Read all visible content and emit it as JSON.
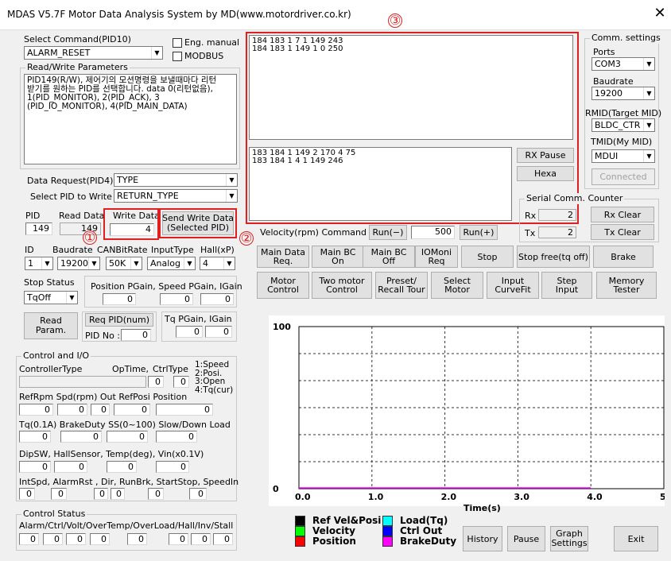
{
  "window": {
    "title": "MDAS V5.7F Motor Data Analysis System by MD(www.motordriver.co.kr)",
    "close": "✕"
  },
  "annotations": {
    "n1": "①",
    "n2": "②",
    "n3": "③"
  },
  "cmd": {
    "label": "Select Command(PID10)",
    "value": "ALARM_RESET",
    "eng_manual": "Eng. manual",
    "modbus": "MODBUS"
  },
  "rw": {
    "title": "Read/Write Parameters",
    "description": "PID149(R/W), 제어기의 모션명령을 보낼때마다 리턴\n받기를 원하는 PID를 선택합니다. data 0(리턴없음),\n1(PID_MONITOR), 2(PID_ACK), 3\n(PID_IO_MONITOR), 4(PID_MAIN_DATA)"
  },
  "data_request": {
    "label": "Data Request(PID4)",
    "value": "TYPE"
  },
  "select_pid": {
    "label": "Select PID to Write",
    "value": "RETURN_TYPE"
  },
  "pid": {
    "label": "PID",
    "value": "149",
    "read_label": "Read Data",
    "read_value": "149",
    "write_label": "Write Data",
    "write_value": "4",
    "send_button": "Send Write Data\n(Selected PID)"
  },
  "idrow": {
    "id_label": "ID",
    "id_value": "1",
    "baud_label": "Baudrate",
    "baud_value": "19200",
    "can_label": "CANBitRate",
    "can_value": "50K",
    "input_label": "InputType",
    "input_value": "Analog",
    "hall_label": "Hall(xP)",
    "hall_value": "4"
  },
  "stop": {
    "label": "Stop Status",
    "value": "TqOff"
  },
  "gains": {
    "label": "Position PGain, Speed PGain, IGain",
    "values": [
      "0",
      "0",
      "0"
    ]
  },
  "read_param": "Read\nParam.",
  "req_pid": {
    "button": "Req PID(num)",
    "pid_no_label": "PID No :",
    "pid_no": "0"
  },
  "tq_gain": {
    "label": "Tq PGain, IGain",
    "values": [
      "0",
      "0"
    ]
  },
  "control_io": {
    "title": "Control and I/O",
    "controller_type": "ControllerType",
    "optime": "OpTime,",
    "ctrltype": "CtrlType",
    "optime_value": "0",
    "ctrltype_value": "0",
    "legend": "1:Speed\n2:Posi.\n3:Open\n4:Tq(cur)",
    "row2_label": "RefRpm  Spd(rpm)  Out  RefPosi   Position",
    "row2_values": [
      "0",
      "0",
      "0",
      "0",
      "0"
    ],
    "row3_label": "Tq(0.1A)  BrakeDuty  SS(0~100)  Slow/Down Load",
    "row3_values": [
      "0",
      "0",
      "0",
      "0"
    ],
    "row4_label": "DipSW, HallSensor,    Temp(deg),  Vin(x0.1V)",
    "row4_values": [
      "0",
      "0",
      "0",
      "0"
    ],
    "row5_label": "IntSpd,  AlarmRst ,  Dir, RunBrk, StartStop,  SpeedIn",
    "row5_values": [
      "0",
      "0",
      "0",
      "0",
      "0",
      "0"
    ]
  },
  "control_status": {
    "title": "Control Status",
    "label": "Alarm/Ctrl/Volt/OverTemp/OverLoad/Hall/Inv/Stall",
    "values": [
      "0",
      "0",
      "0",
      "0",
      "0",
      "0",
      "0",
      "0"
    ]
  },
  "rx_text": "184 183 1 7 1 149 243\n184 183 1 149 1 0 250",
  "tx_text": "183 184 1 149 2 170 4 75\n183 184 1 4 1 149 246",
  "rx_pause": "RX Pause",
  "hexa": "Hexa",
  "comm": {
    "title": "Comm. settings",
    "ports_label": "Ports",
    "ports_value": "COM3",
    "baud_label": "Baudrate",
    "baud_value": "19200",
    "rmid_label": "RMID(Target MID)",
    "rmid_value": "BLDC_CTR",
    "tmid_label": "TMID(My MID)",
    "tmid_value": "MDUI",
    "connected": "Connected"
  },
  "serial": {
    "title": "Serial Comm. Counter",
    "rx_label": "Rx",
    "rx_value": "2",
    "tx_label": "Tx",
    "tx_value": "2",
    "rx_clear": "Rx Clear",
    "tx_clear": "Tx Clear"
  },
  "velocity": {
    "label": "Velocity(rpm) Command",
    "run_minus": "Run(−)",
    "value": "500",
    "run_plus": "Run(+)"
  },
  "buttons1": [
    "Main Data\nReq.",
    "Main BC\nOn",
    "Main BC\nOff",
    "IOMoni\nReq",
    "Stop",
    "Stop free(tq off)",
    "Brake"
  ],
  "buttons2": [
    "Motor\nControl",
    "Two motor\nControl",
    "Preset/\nRecall Tour",
    "Select\nMotor",
    "Input\nCurveFit",
    "Step\nInput",
    "Memory\nTester"
  ],
  "chart_data": {
    "type": "line",
    "xlabel": "Time(s)",
    "ylabel": "",
    "x_ticks": [
      "0.0",
      "1.0",
      "2.0",
      "3.0",
      "4.0",
      "5.0"
    ],
    "y_ticks": [
      "0",
      "100"
    ],
    "xlim": [
      0,
      5
    ],
    "ylim": [
      0,
      100
    ],
    "grid": true,
    "series": [
      {
        "name": "Ref Vel&Posi",
        "color": "#000000",
        "values": []
      },
      {
        "name": "Velocity",
        "color": "#00ff00",
        "values": []
      },
      {
        "name": "Position",
        "color": "#ff0000",
        "values": []
      },
      {
        "name": "Load(Tq)",
        "color": "#00ffff",
        "values": []
      },
      {
        "name": "Ctrl Out",
        "color": "#0000ff",
        "values": []
      },
      {
        "name": "BrakeDuty",
        "color": "#ff00ff",
        "x": [
          0,
          4
        ],
        "values": [
          0,
          0
        ]
      }
    ]
  },
  "bottom_buttons": {
    "history": "History",
    "pause": "Pause",
    "graph_settings": "Graph\nSettings",
    "exit": "Exit"
  }
}
